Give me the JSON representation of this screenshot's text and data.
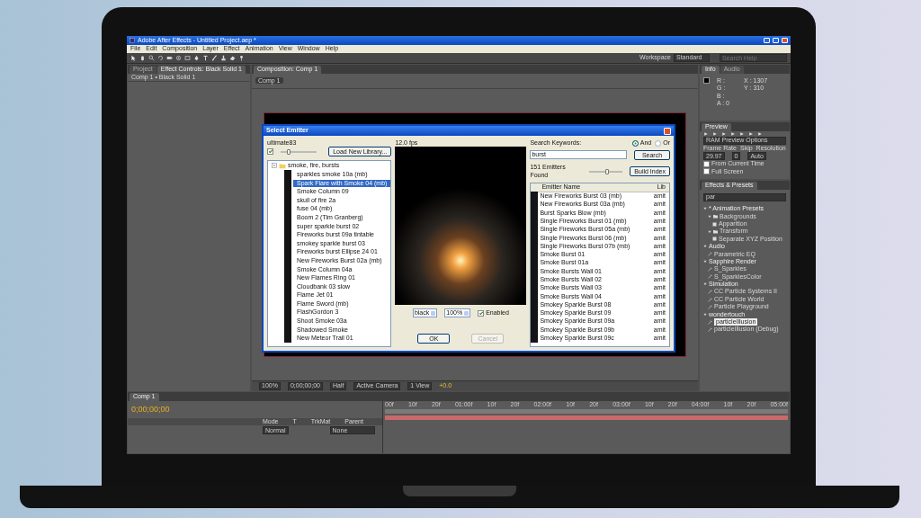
{
  "window": {
    "title": "Adobe After Effects - Untitled Project.aep *"
  },
  "menu": [
    "File",
    "Edit",
    "Composition",
    "Layer",
    "Effect",
    "Animation",
    "View",
    "Window",
    "Help"
  ],
  "toolbar": {
    "workspace_label": "Workspace",
    "workspace": "Standard",
    "search_placeholder": "Search Help"
  },
  "project_panel": {
    "tabs": [
      {
        "label": "Project",
        "selected": false
      },
      {
        "label": "Effect Controls: Black Solid 1",
        "selected": true
      }
    ],
    "subtitle": "Comp 1 • Black Solid 1"
  },
  "composition_panel": {
    "tab": "Composition: Comp 1",
    "comp_button": "Comp 1",
    "viewer_bar": [
      "100%",
      "0;00;00;00",
      "Half",
      "Active Camera",
      "1 View",
      "+0.0"
    ]
  },
  "info_panel": {
    "tabs": [
      {
        "label": "Info",
        "selected": true
      },
      {
        "label": "Audio",
        "selected": false
      }
    ],
    "channels": [
      "R :",
      "G :",
      "B :",
      "A : 0"
    ],
    "coords": [
      "X : 1307",
      "Y : 310"
    ]
  },
  "preview_panel": {
    "title": "Preview",
    "ram_options": "RAM Preview Options",
    "labels": [
      "Frame Rate",
      "Skip",
      "Resolution"
    ],
    "values": [
      "29.97",
      "0",
      "Auto"
    ],
    "options": [
      {
        "label": "From Current Time",
        "checked": false
      },
      {
        "label": "Full Screen",
        "checked": false
      }
    ]
  },
  "effects_panel": {
    "title": "Effects & Presets",
    "search": "par",
    "tree": [
      {
        "label": "* Animation Presets",
        "kind": "category",
        "expanded": true,
        "selected": false,
        "children": [
          {
            "label": "Backgrounds",
            "kind": "folder",
            "expanded": true,
            "selected": false,
            "children": [
              {
                "label": "Apparition",
                "kind": "preset",
                "selected": false
              }
            ]
          },
          {
            "label": "Transform",
            "kind": "folder",
            "expanded": true,
            "selected": false,
            "children": [
              {
                "label": "Separate XYZ Position",
                "kind": "preset",
                "selected": false
              }
            ]
          }
        ]
      },
      {
        "label": "Audio",
        "kind": "category",
        "expanded": true,
        "selected": false,
        "children": [
          {
            "label": "Parametric EQ",
            "kind": "effect",
            "selected": false
          }
        ]
      },
      {
        "label": "Sapphire Render",
        "kind": "category",
        "expanded": true,
        "selected": false,
        "children": [
          {
            "label": "S_Sparkles",
            "kind": "effect",
            "selected": false
          },
          {
            "label": "S_SparklesColor",
            "kind": "effect",
            "selected": false
          }
        ]
      },
      {
        "label": "Simulation",
        "kind": "category",
        "expanded": true,
        "selected": false,
        "children": [
          {
            "label": "CC Particle Systems II",
            "kind": "effect",
            "selected": false
          },
          {
            "label": "CC Particle World",
            "kind": "effect",
            "selected": false
          },
          {
            "label": "Particle Playground",
            "kind": "effect",
            "selected": false
          }
        ]
      },
      {
        "label": "wondertouch",
        "kind": "category",
        "expanded": true,
        "selected": false,
        "children": [
          {
            "label": "particleIllusion",
            "kind": "effect",
            "selected": true
          },
          {
            "label": "particleIllusion (Debug)",
            "kind": "effect",
            "selected": false
          }
        ]
      }
    ]
  },
  "timeline": {
    "tab": "Comp 1",
    "timecode": "0;00;00;00",
    "columns": [
      "Mode",
      "T",
      "TrkMat",
      "Parent"
    ],
    "layer": {
      "mode": "Normal",
      "parent": "None"
    },
    "ruler": [
      "00f",
      "10f",
      "20f",
      "01:00f",
      "10f",
      "20f",
      "02:00f",
      "10f",
      "20f",
      "03:00f",
      "10f",
      "20f",
      "04:00f",
      "10f",
      "20f",
      "05:00f"
    ]
  },
  "dialog": {
    "title": "Select Emitter",
    "library": "ultimate83",
    "thumbs_checked": true,
    "thumb_size": {
      "level": 0.2
    },
    "load_button": "Load New Library...",
    "folder": {
      "label": "smoke, fire, bursts",
      "expanded": true
    },
    "emitters": [
      {
        "label": "sparkles smoke 10a (mb)",
        "selected": false
      },
      {
        "label": "Spark Flare with Smoke 04 (mb)",
        "selected": true
      },
      {
        "label": "Smoke Column 09",
        "selected": false
      },
      {
        "label": "skull of fire 2a",
        "selected": false
      },
      {
        "label": "fuse 04 (mb)",
        "selected": false
      },
      {
        "label": "Boom 2 (Tim Granberg)",
        "selected": false
      },
      {
        "label": "super sparkle burst 02",
        "selected": false
      },
      {
        "label": "Fireworks burst 09a tintable",
        "selected": false
      },
      {
        "label": "smokey sparkle burst 03",
        "selected": false
      },
      {
        "label": "Fireworks burst Ellipse 24 01",
        "selected": false
      },
      {
        "label": "New Fireworks Burst 02a (mb)",
        "selected": false
      },
      {
        "label": "Smoke Column 04a",
        "selected": false
      },
      {
        "label": "New Flames Ring 01",
        "selected": false
      },
      {
        "label": "Cloudbank 03 slow",
        "selected": false
      },
      {
        "label": "Flame Jet 01",
        "selected": false
      },
      {
        "label": "Flame Sword (mb)",
        "selected": false
      },
      {
        "label": "FlashGordon 3",
        "selected": false
      },
      {
        "label": "Shoot Smoke 03a",
        "selected": false
      },
      {
        "label": "Shadowed Smoke",
        "selected": false
      },
      {
        "label": "New Meteor Trail 01",
        "selected": false
      }
    ],
    "fps": "12.0 fps",
    "background": "black",
    "zoom": "100%",
    "enabled": {
      "label": "Enabled",
      "checked": true
    },
    "ok": "OK",
    "cancel": {
      "label": "Cancel",
      "disabled": true
    },
    "search_label": "Search Keywords:",
    "modes": [
      {
        "label": "And",
        "selected": true
      },
      {
        "label": "Or",
        "selected": false
      }
    ],
    "keyword": "burst",
    "search_button": "Search",
    "found": "151 Emitters Found",
    "found_slider": {
      "level": 0.5
    },
    "build_index": "Build Index",
    "columns": [
      "Emitter Name",
      "Lib"
    ],
    "results": [
      {
        "name": "New Fireworks Burst 03 (mb)",
        "lib": "amit"
      },
      {
        "name": "New Fireworks Burst 03a (mb)",
        "lib": "amit"
      },
      {
        "name": "Burst Sparks Blow (mb)",
        "lib": "amit"
      },
      {
        "name": "Single Fireworks Burst 01 (mb)",
        "lib": "amit"
      },
      {
        "name": "Single Fireworks Burst 05a (mb)",
        "lib": "amit"
      },
      {
        "name": "Single Fireworks Burst 06 (mb)",
        "lib": "amit"
      },
      {
        "name": "Single Fireworks Burst 07b (mb)",
        "lib": "amit"
      },
      {
        "name": "Smoke Burst 01",
        "lib": "amit"
      },
      {
        "name": "Smoke Burst 01a",
        "lib": "amit"
      },
      {
        "name": "Smoke Bursts Wall 01",
        "lib": "amit"
      },
      {
        "name": "Smoke Bursts Wall 02",
        "lib": "amit"
      },
      {
        "name": "Smoke Bursts Wall 03",
        "lib": "amit"
      },
      {
        "name": "Smoke Bursts Wall 04",
        "lib": "amit"
      },
      {
        "name": "Smokey Sparkle Burst 08",
        "lib": "amit"
      },
      {
        "name": "Smokey Sparkle Burst 09",
        "lib": "amit"
      },
      {
        "name": "Smokey Sparkle Burst 09a",
        "lib": "amit"
      },
      {
        "name": "Smokey Sparkle Burst 09b",
        "lib": "amit"
      },
      {
        "name": "Smokey Sparkle Burst 09c",
        "lib": "amit"
      }
    ]
  }
}
